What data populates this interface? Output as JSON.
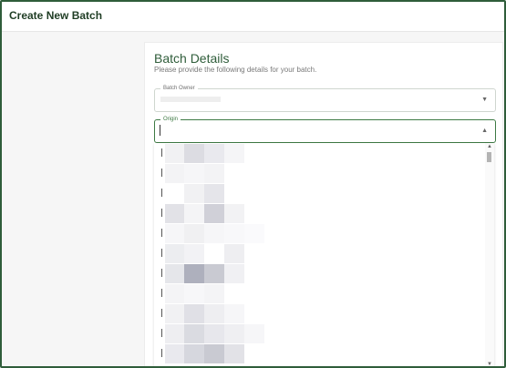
{
  "window": {
    "title": "Create New Batch"
  },
  "section": {
    "title": "Batch Details",
    "subtitle": "Please provide the following details for your batch."
  },
  "fields": {
    "owner_label": "Batch Owner",
    "origin_label": "Origin"
  },
  "dropdown": {
    "arrow_closed": "▼",
    "arrow_open": "▲",
    "scroll_up": "▲",
    "scroll_down": "▼",
    "row_count": 11
  }
}
